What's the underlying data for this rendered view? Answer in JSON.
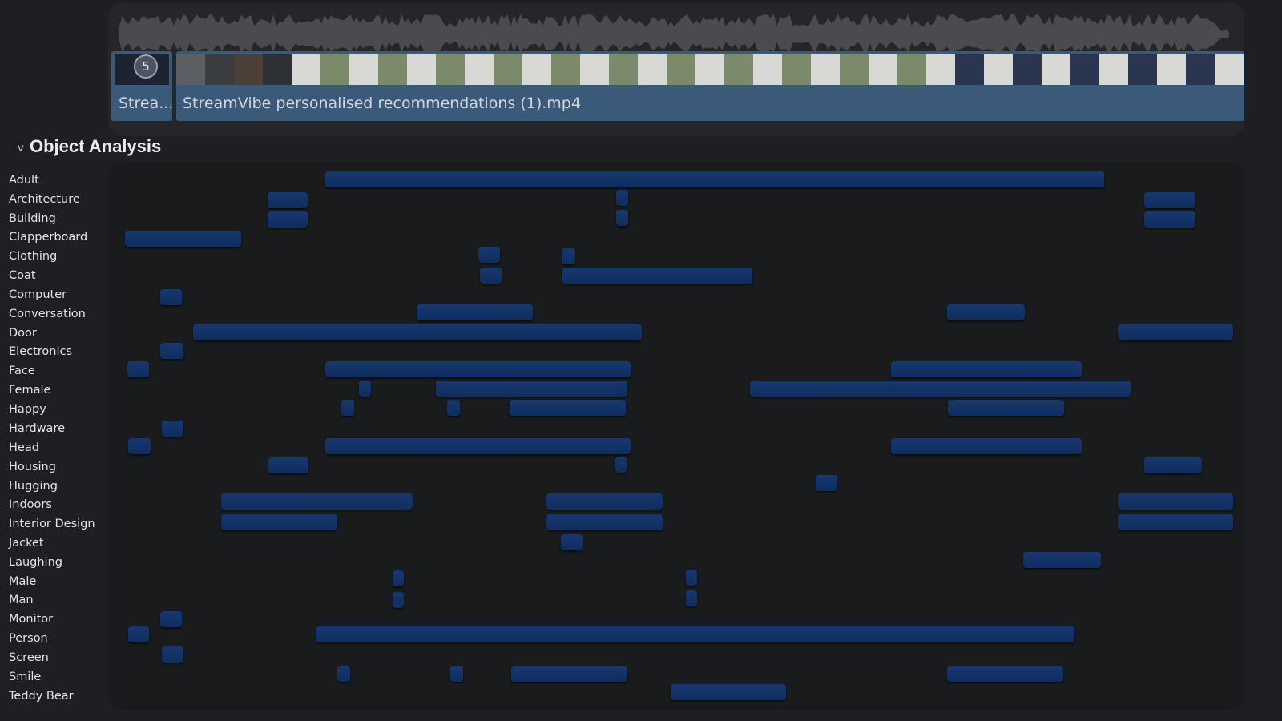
{
  "timeline": {
    "clip_badge": "5",
    "clip_short_title": "Strea...",
    "clip_title": "StreamVibe personalised recommendations (1).mp4"
  },
  "section": {
    "toggle_glyph": "v",
    "title": "Object Analysis"
  },
  "labels": [
    "Adult",
    "Architecture",
    "Building",
    "Clapperboard",
    "Clothing",
    "Coat",
    "Computer",
    "Conversation",
    "Door",
    "Electronics",
    "Face",
    "Female",
    "Happy",
    "Hardware",
    "Head",
    "Housing",
    "Hugging",
    "Indoors",
    "Interior Design",
    "Jacket",
    "Laughing",
    "Male",
    "Man",
    "Monitor",
    "Person",
    "Screen",
    "Smile",
    "Teddy Bear"
  ],
  "colors": {
    "bar": "#153a72",
    "clip": "#3b5a7a",
    "panel": "#252629"
  }
}
